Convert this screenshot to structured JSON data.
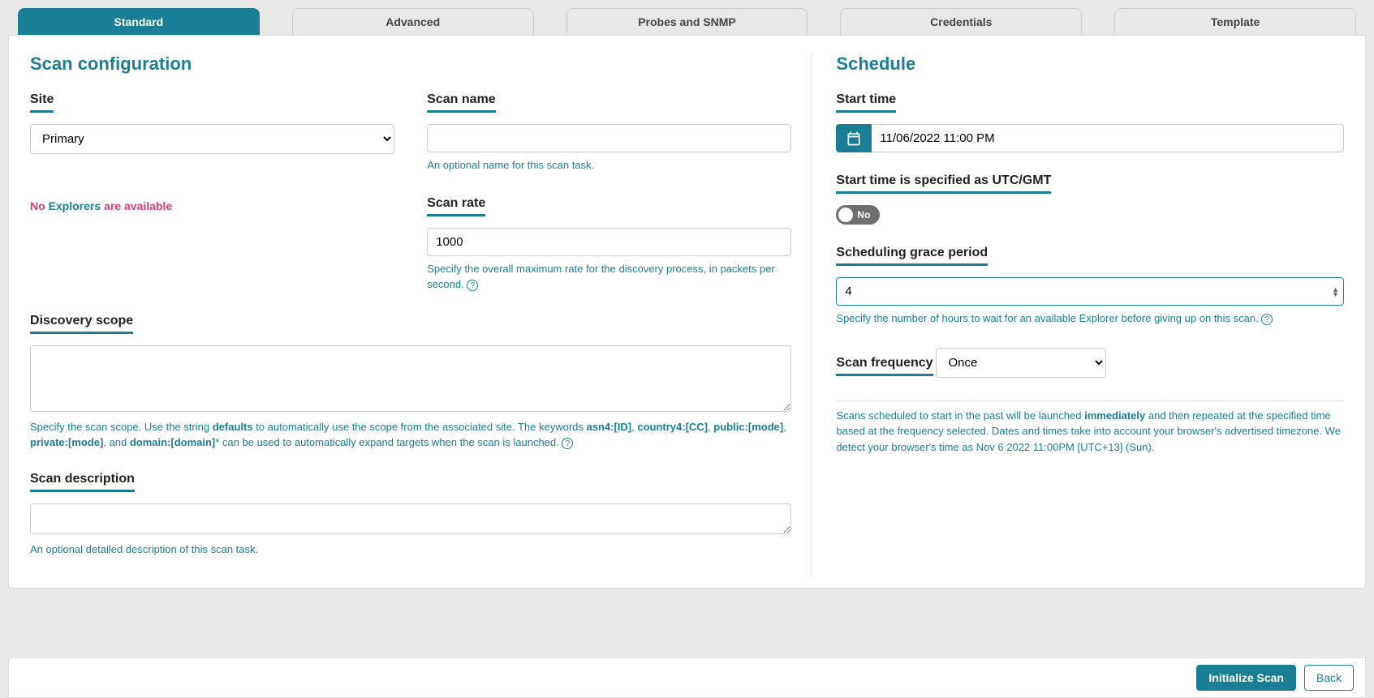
{
  "tabs": {
    "standard": "Standard",
    "advanced": "Advanced",
    "probes": "Probes and SNMP",
    "credentials": "Credentials",
    "template": "Template"
  },
  "scan_config": {
    "heading": "Scan configuration",
    "site_label": "Site",
    "site_value": "Primary",
    "scan_name_label": "Scan name",
    "scan_name_help": "An optional name for this scan task.",
    "explorers_warn": {
      "prefix": "No",
      "link": "Explorers",
      "suffix": "are available"
    },
    "scan_rate_label": "Scan rate",
    "scan_rate_value": "1000",
    "scan_rate_help": "Specify the overall maximum rate for the discovery process, in packets per second.",
    "scope_label": "Discovery scope",
    "scope_help_1": "Specify the scan scope. Use the string ",
    "scope_kw_defaults": "defaults",
    "scope_help_2": " to automatically use the scope from the associated site. The keywords ",
    "scope_kw_asn4": "asn4:[ID]",
    "scope_kw_country": "country4:[CC]",
    "scope_kw_public": "public:[mode]",
    "scope_kw_private": "private:[mode]",
    "scope_help_and": ", and ",
    "scope_kw_domain": "domain:[domain]",
    "scope_help_3": "* can be used to automatically expand targets when the scan is launched.",
    "desc_label": "Scan description",
    "desc_help": "An optional detailed description of this scan task."
  },
  "schedule": {
    "heading": "Schedule",
    "start_time_label": "Start time",
    "start_time_value": "11/06/2022 11:00 PM",
    "utc_label": "Start time is specified as UTC/GMT",
    "utc_toggle_text": "No",
    "grace_label": "Scheduling grace period",
    "grace_value": "4",
    "grace_help": "Specify the number of hours to wait for an available Explorer before giving up on this scan.",
    "freq_label": "Scan frequency",
    "freq_value": "Once",
    "freq_help_1": "Scans scheduled to start in the past will be launched ",
    "freq_help_bold": "immediately",
    "freq_help_2": " and then repeated at the specified time based at the frequency selected. Dates and times take into account your browser's advertised timezone. We detect your browser's time as Nov 6 2022 11:00PM [UTC+13] (Sun)."
  },
  "buttons": {
    "initialize": "Initialize Scan",
    "back": "Back"
  },
  "sep": ", "
}
